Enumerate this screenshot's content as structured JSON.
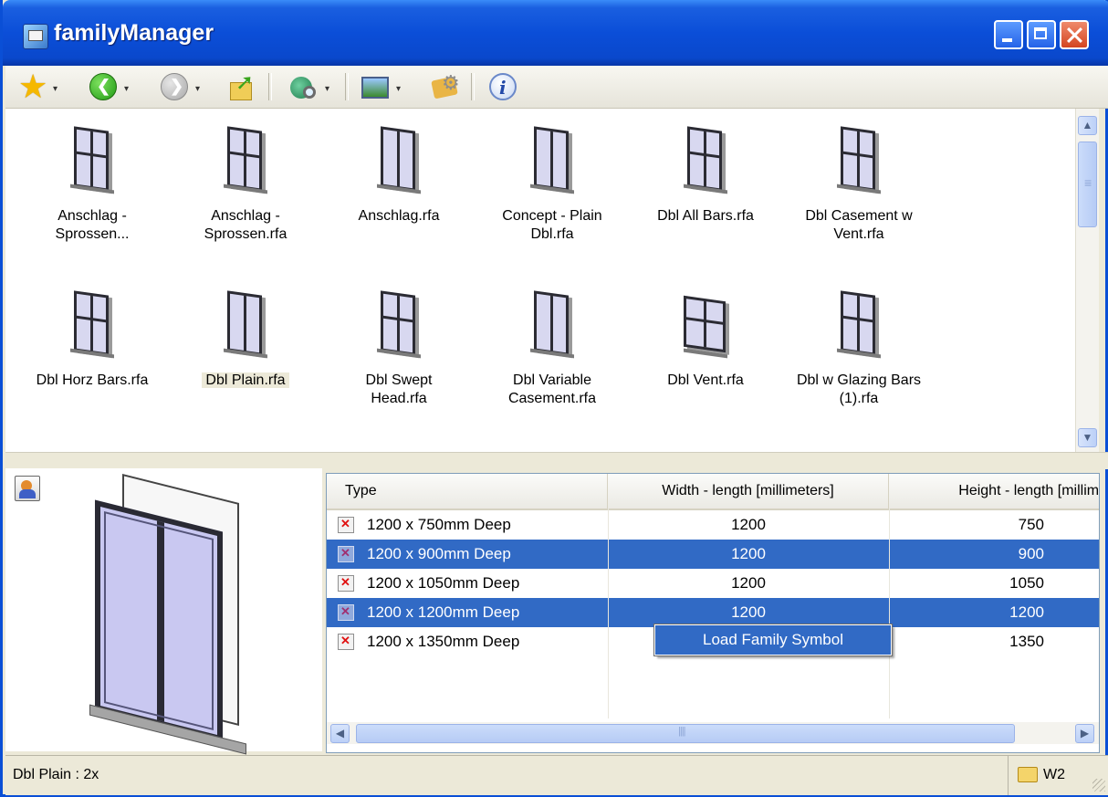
{
  "window": {
    "title": "familyManager"
  },
  "toolbar": {
    "icons": [
      "favorites-star-icon",
      "back-arrow-icon",
      "forward-arrow-icon",
      "up-folder-icon",
      "search-globe-icon",
      "views-icon",
      "settings-icon",
      "info-icon"
    ]
  },
  "gallery": {
    "items": [
      {
        "label": "Anschlag -\nSprossen...",
        "style": "bars"
      },
      {
        "label": "Anschlag -\nSprossen.rfa",
        "style": "bars"
      },
      {
        "label": "Anschlag.rfa",
        "style": "plain"
      },
      {
        "label": "Concept - Plain\nDbl.rfa",
        "style": "plain"
      },
      {
        "label": "Dbl All Bars.rfa",
        "style": "bars"
      },
      {
        "label": "Dbl Casement w\nVent.rfa",
        "style": "vent"
      },
      {
        "label": "Dbl Horz Bars.rfa",
        "style": "horz"
      },
      {
        "label": "Dbl Plain.rfa",
        "style": "plain",
        "selected": true
      },
      {
        "label": "Dbl Swept\nHead.rfa",
        "style": "horz"
      },
      {
        "label": "Dbl Variable\nCasement.rfa",
        "style": "plain"
      },
      {
        "label": "Dbl Vent.rfa",
        "style": "wide"
      },
      {
        "label": "Dbl w Glazing Bars\n(1).rfa",
        "style": "bars"
      }
    ]
  },
  "table": {
    "columns": [
      "Type",
      "Width - length [millimeters]",
      "Height - length [millime"
    ],
    "rows": [
      {
        "type": "1200 x 750mm Deep",
        "width": "1200",
        "height": "750",
        "selected": false
      },
      {
        "type": "1200 x 900mm Deep",
        "width": "1200",
        "height": "900",
        "selected": true
      },
      {
        "type": "1200 x 1050mm Deep",
        "width": "1200",
        "height": "1050",
        "selected": false
      },
      {
        "type": "1200 x 1200mm Deep",
        "width": "1200",
        "height": "1200",
        "selected": true
      },
      {
        "type": "1200 x 1350mm Deep",
        "width": "",
        "height": "1350",
        "selected": false
      }
    ]
  },
  "context_menu": {
    "item": "Load Family Symbol"
  },
  "status": {
    "text": "Dbl Plain : 2x",
    "folder": "W2"
  },
  "colors": {
    "title_bar": "#0a48cc",
    "selection": "#316ac5",
    "chrome": "#ece9d8"
  }
}
